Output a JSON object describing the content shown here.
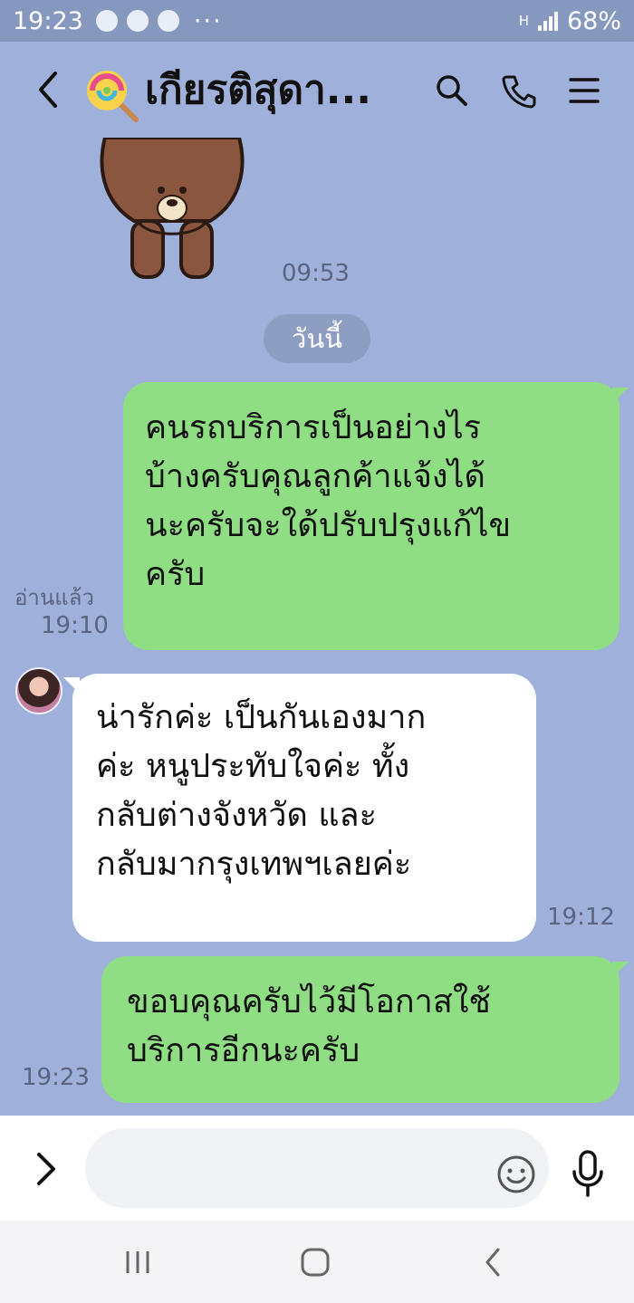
{
  "status_bar": {
    "time": "19:23",
    "more": "···",
    "battery": "68%",
    "network": "H"
  },
  "header": {
    "title": "เกียรติสุดา...",
    "icons": [
      "back-arrow-icon",
      "lollipop-icon",
      "search-icon",
      "phone-icon",
      "menu-icon"
    ]
  },
  "chat": {
    "sticker_time": "09:53",
    "date_divider": "วันนี้",
    "messages": [
      {
        "side": "sent",
        "lines": [
          "คนรถบริการเป็นอย่างไร",
          "บ้างครับคุณลูกค้าแจ้งได้",
          "นะครับจะใด้ปรับปรุงแก้ไข",
          "ครับ"
        ],
        "read_label": "อ่านแล้ว",
        "time": "19:10"
      },
      {
        "side": "received",
        "lines": [
          "น่ารักค่ะ เป็นกันเองมาก",
          "ค่ะ หนูประทับใจค่ะ ทั้ง",
          "กลับต่างจังหวัด และ",
          "กลับมากรุงเทพฯเลยค่ะ"
        ],
        "time": "19:12"
      },
      {
        "side": "sent",
        "lines": [
          "ขอบคุณครับไว้มีโอกาสใช้",
          "บริการอีกนะครับ"
        ],
        "time": "19:23"
      }
    ]
  },
  "input_bar": {
    "placeholder": "",
    "icons": [
      "chevron-right-icon",
      "smiley-icon",
      "microphone-icon"
    ]
  },
  "nav_bar": {
    "icons": [
      "recent-apps-icon",
      "home-icon",
      "back-icon"
    ]
  },
  "colors": {
    "chat_background": "#9fb1db",
    "sent_bubble": "#8fde83",
    "received_bubble": "#ffffff",
    "status_bar": "#8798bf",
    "date_pill": "#8e9dc2"
  }
}
